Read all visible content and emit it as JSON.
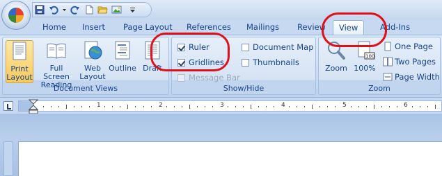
{
  "quick_access": {
    "icons": [
      "save-icon",
      "undo-icon",
      "undo-dropdown-icon",
      "redo-icon",
      "new-document-icon",
      "open-folder-icon",
      "insert-picture-icon",
      "customize-dropdown-icon"
    ]
  },
  "tabs": [
    {
      "label": "Home"
    },
    {
      "label": "Insert"
    },
    {
      "label": "Page Layout"
    },
    {
      "label": "References"
    },
    {
      "label": "Mailings"
    },
    {
      "label": "Review"
    },
    {
      "label": "View",
      "active": true
    },
    {
      "label": "Add-Ins"
    }
  ],
  "ribbon": {
    "document_views": {
      "title": "Document Views",
      "buttons": [
        {
          "line1": "Print",
          "line2": "Layout",
          "selected": true
        },
        {
          "line1": "Full Screen",
          "line2": "Reading"
        },
        {
          "line1": "Web",
          "line2": "Layout"
        },
        {
          "line1": "Outline",
          "line2": ""
        },
        {
          "line1": "Draft",
          "line2": ""
        }
      ]
    },
    "show_hide": {
      "title": "Show/Hide",
      "checkboxes": [
        {
          "label": "Ruler",
          "checked": true
        },
        {
          "label": "Gridlines",
          "checked": true
        },
        {
          "label": "Message Bar",
          "checked": false,
          "disabled": true
        },
        {
          "label": "Document Map",
          "checked": false
        },
        {
          "label": "Thumbnails",
          "checked": false
        }
      ]
    },
    "zoom": {
      "title": "Zoom",
      "zoom_label": "Zoom",
      "percent_label": "100%",
      "one_page": "One Page",
      "two_pages": "Two Pages",
      "page_width": "Page Width"
    }
  },
  "ruler": {
    "numbers": [
      "1",
      "2",
      "3",
      "4",
      "5",
      "6"
    ]
  },
  "colors": {
    "annotation": "#e0101a",
    "ribbon_text": "#15428b",
    "selected_button": "#f7c95b"
  }
}
